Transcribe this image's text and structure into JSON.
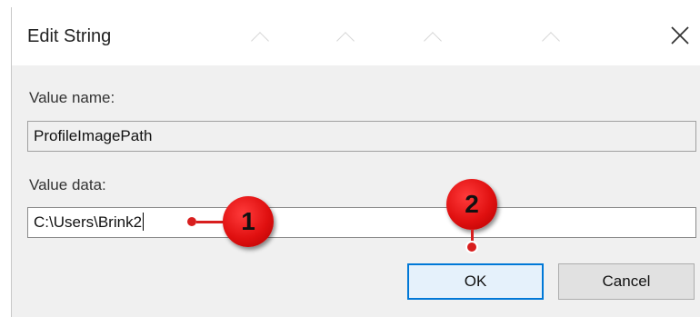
{
  "dialog": {
    "title": "Edit String",
    "close_glyph": "✕",
    "value_name_label": "Value name:",
    "value_name": "ProfileImagePath",
    "value_data_label": "Value data:",
    "value_data": "C:\\Users\\Brink2",
    "ok_label": "OK",
    "cancel_label": "Cancel"
  },
  "callouts": [
    {
      "number": "1"
    },
    {
      "number": "2"
    }
  ],
  "colors": {
    "accent": "#0078d7",
    "callout": "#d81e1e"
  },
  "icons": {
    "close": "close-icon"
  }
}
